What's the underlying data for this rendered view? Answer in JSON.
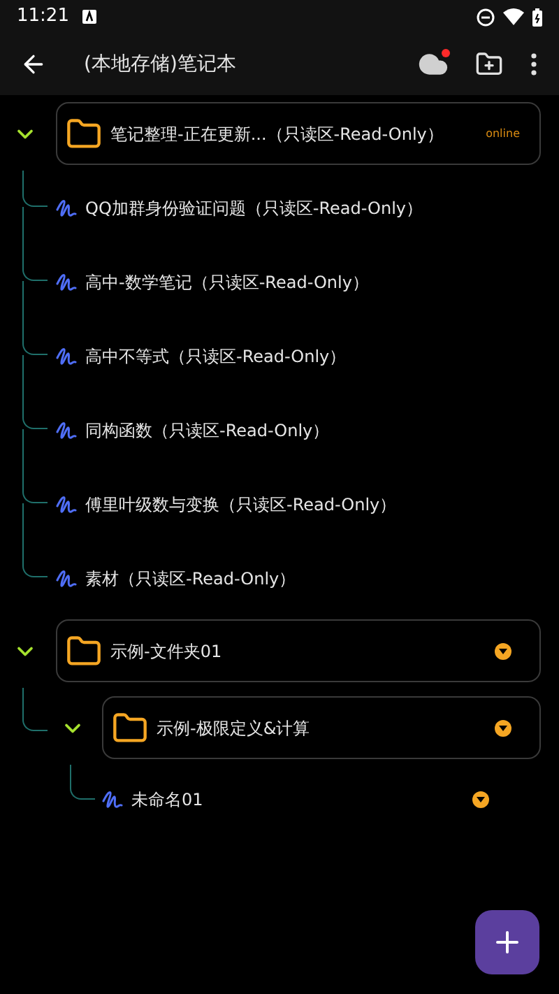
{
  "status_bar": {
    "time": "11:21"
  },
  "app_bar": {
    "title": "(本地存储)笔记本",
    "cloud_alert": true
  },
  "tree": [
    {
      "kind": "folder",
      "title": "笔记整理-正在更新...（只读区-Read-Only）",
      "expanded": true,
      "status": "online",
      "children": [
        {
          "kind": "note",
          "title": "QQ加群身份验证问题（只读区-Read-Only）",
          "menu_button": false
        },
        {
          "kind": "note",
          "title": "高中-数学笔记（只读区-Read-Only）",
          "menu_button": false
        },
        {
          "kind": "note",
          "title": "高中不等式（只读区-Read-Only）",
          "menu_button": false
        },
        {
          "kind": "note",
          "title": "同构函数（只读区-Read-Only）",
          "menu_button": false
        },
        {
          "kind": "note",
          "title": "傅里叶级数与变换（只读区-Read-Only）",
          "menu_button": false
        },
        {
          "kind": "note",
          "title": "素材（只读区-Read-Only）",
          "menu_button": false
        }
      ]
    },
    {
      "kind": "folder",
      "title": "示例-文件夹01",
      "expanded": true,
      "menu_button": true,
      "children": [
        {
          "kind": "folder",
          "title": "示例-极限定义&计算",
          "expanded": true,
          "menu_button": true,
          "children": [
            {
              "kind": "note",
              "title": "未命名01",
              "menu_button": true
            }
          ]
        }
      ]
    }
  ]
}
